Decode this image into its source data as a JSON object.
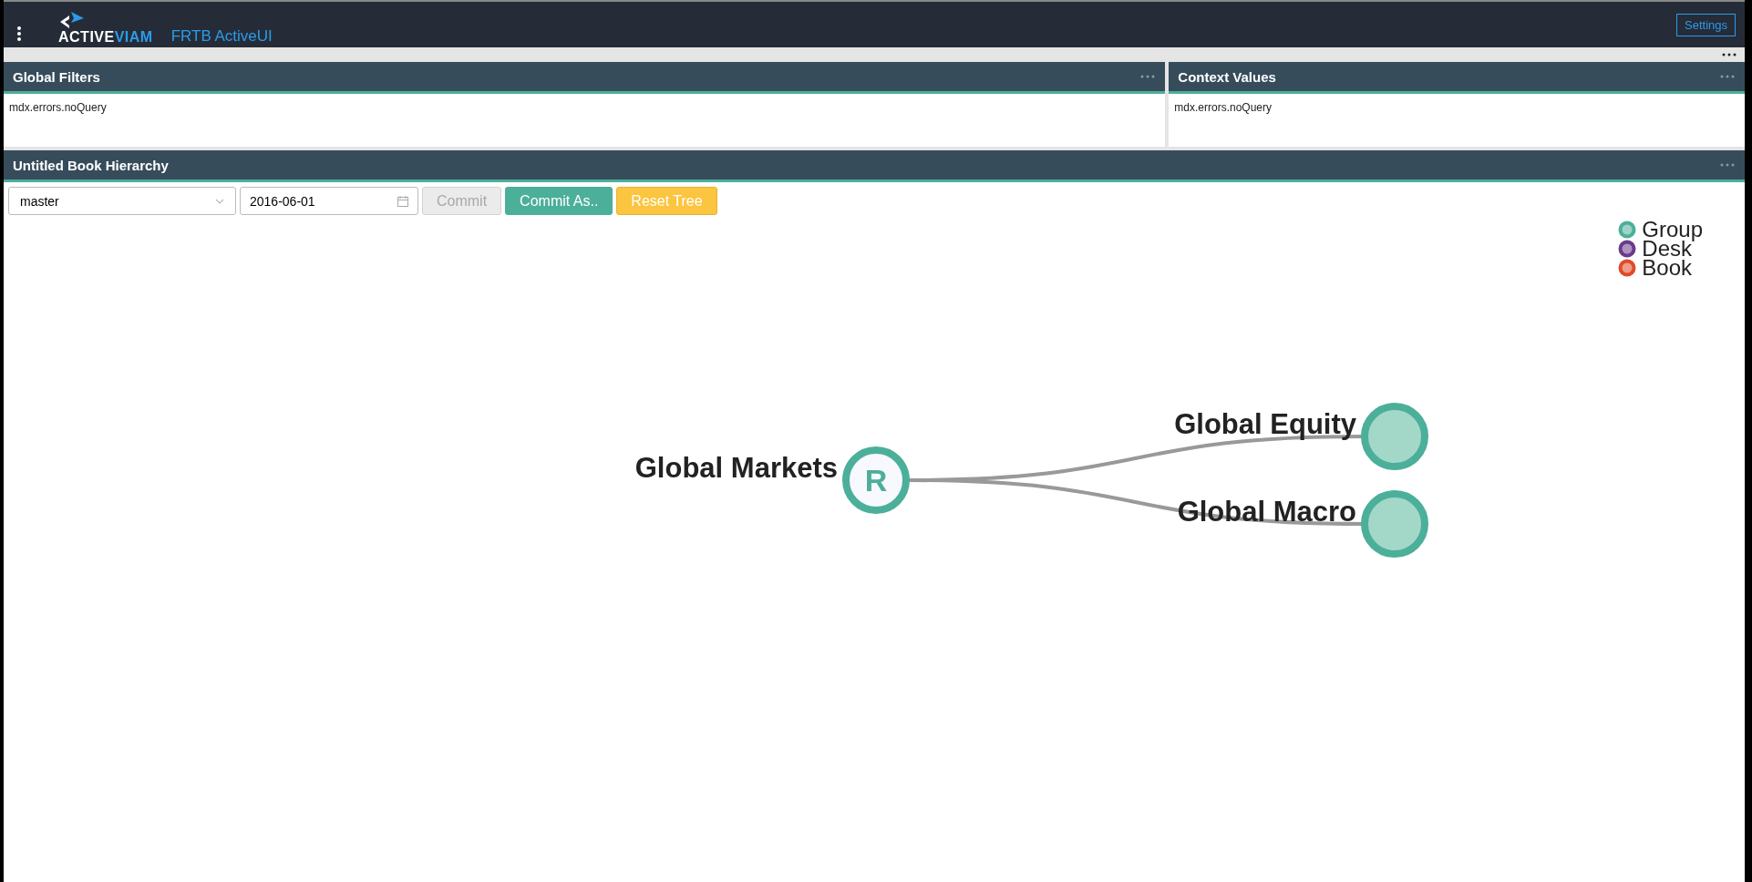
{
  "app_bar": {
    "logo": {
      "part_1": "ACTIVE",
      "part_2": "VIAM"
    },
    "app_name": "FRTB ActiveUI",
    "settings_button": "Settings"
  },
  "panels": [
    {
      "title": "Global Filters",
      "message": "mdx.errors.noQuery"
    },
    {
      "title": "Context Values",
      "message": "mdx.errors.noQuery"
    }
  ],
  "book_hierarchy": {
    "title": "Untitled Book Hierarchy",
    "branch_select": {
      "value": "master"
    },
    "date_field": {
      "value": "2016-06-01"
    },
    "buttons": [
      {
        "label": "Commit",
        "kind": "plain",
        "disabled": true
      },
      {
        "label": "Commit As..",
        "kind": "primary",
        "disabled": false
      },
      {
        "label": "Reset Tree",
        "kind": "warning",
        "disabled": false
      }
    ],
    "legend": [
      {
        "label": "Group",
        "color": "#4caf9a"
      },
      {
        "label": "Desk",
        "color": "#6a3a8c"
      },
      {
        "label": "Book",
        "color": "#e04a2a"
      }
    ],
    "tree": {
      "label": "Global Markets",
      "kind": "group",
      "badge": "R",
      "children": [
        {
          "label": "Global Equity",
          "kind": "group"
        },
        {
          "label": "Global Macro",
          "kind": "group"
        }
      ]
    }
  }
}
